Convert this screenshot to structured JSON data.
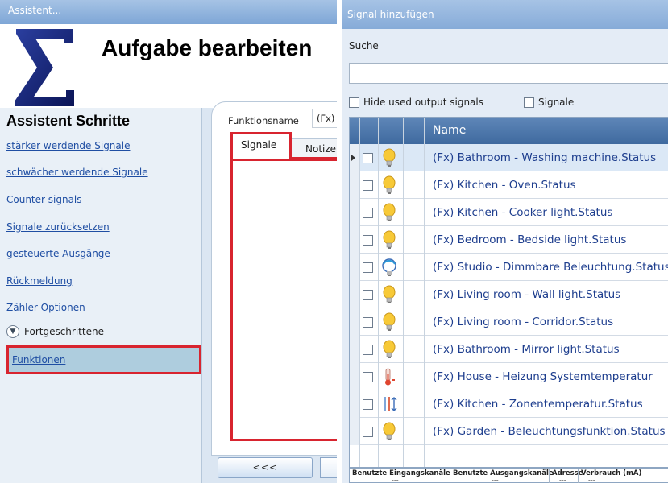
{
  "left_window": {
    "title": "Assistent...",
    "heading": "Aufgabe bearbeiten",
    "steps_title": "Assistent Schritte",
    "steps": [
      "stärker werdende Signale",
      "schwächer werdende Signale",
      "Counter signals",
      "Signale zurücksetzen",
      "gesteuerte Ausgänge",
      "Rückmeldung",
      "Zähler Optionen"
    ],
    "advanced_label": "Fortgeschrittene",
    "selected_step": "Funktionen",
    "function_name_label": "Funktionsname",
    "function_name_value": "(Fx)",
    "tabs": [
      "Signale",
      "Notize"
    ],
    "back_button": "<<<"
  },
  "right_window": {
    "title": "Signal hinzufügen",
    "search_label": "Suche",
    "search_value": "",
    "hide_used_label": "Hide used output signals",
    "signale_label": "Signale",
    "column_name": "Name",
    "rows": [
      {
        "name": "(Fx) Bathroom - Washing machine.Status",
        "icon": "bulb-icon",
        "selected": true
      },
      {
        "name": "(Fx) Kitchen - Oven.Status",
        "icon": "bulb-icon",
        "selected": false
      },
      {
        "name": "(Fx) Kitchen - Cooker light.Status",
        "icon": "bulb-icon",
        "selected": false
      },
      {
        "name": "(Fx) Bedroom - Bedside light.Status",
        "icon": "bulb-icon",
        "selected": false
      },
      {
        "name": "(Fx) Studio - Dimmbare Beleuchtung.Status",
        "icon": "dimmer-icon",
        "selected": false
      },
      {
        "name": "(Fx) Living room - Wall light.Status",
        "icon": "bulb-icon",
        "selected": false
      },
      {
        "name": "(Fx) Living room - Corridor.Status",
        "icon": "bulb-icon",
        "selected": false
      },
      {
        "name": "(Fx) Bathroom - Mirror light.Status",
        "icon": "bulb-icon",
        "selected": false
      },
      {
        "name": "(Fx) House - Heizung Systemtemperatur",
        "icon": "thermometer-icon",
        "selected": false
      },
      {
        "name": "(Fx) Kitchen - Zonentemperatur.Status",
        "icon": "zone-temperature-icon",
        "selected": false
      },
      {
        "name": "(Fx) Garden - Beleuchtungsfunktion.Status",
        "icon": "bulb-icon",
        "selected": false
      }
    ],
    "footer": {
      "headers": [
        "Benutzte Eingangskanäle",
        "Benutzte Ausgangskanäle",
        "Adresse",
        "Verbrauch (mA)"
      ],
      "values": [
        "---",
        "---",
        "---",
        "---"
      ]
    }
  },
  "colors": {
    "highlight_red": "#d8242f",
    "title_blue": "#86abd8",
    "header_blue": "#4a73a8",
    "link_blue": "#1f4ea3",
    "selected_row": "#dbe8f6",
    "sigma_blue": "#11206a"
  }
}
